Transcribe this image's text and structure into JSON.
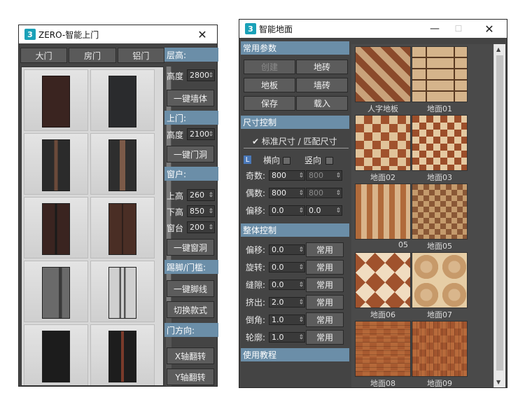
{
  "window1": {
    "title": "ZERO-智能上门",
    "tabs": [
      "大门",
      "房门",
      "铝门"
    ],
    "sections": {
      "layer_height": "层高:",
      "door": "上门:",
      "window": "窗户:",
      "skirting": "踢脚/门槛:",
      "door_dir": "门方向:"
    },
    "labels": {
      "height": "高度",
      "door_height": "高度",
      "upper_height": "上高",
      "lower_height": "下高",
      "sill": "窗台"
    },
    "values": {
      "height": "2800",
      "door_height": "2100",
      "upper_height": "260",
      "lower_height": "850",
      "sill": "200"
    },
    "buttons": {
      "wall": "一键墙体",
      "door_opening": "一键门洞",
      "window_opening": "一键窗洞",
      "skirting": "一键脚线",
      "switch_style": "切换款式",
      "flip_x": "X轴翻转",
      "flip_y": "Y轴翻转"
    },
    "colors": {
      "section_bg": "#6b8ea8",
      "panel_bg": "#444444"
    }
  },
  "window2": {
    "title": "智能地面",
    "sections": {
      "common": "常用参数",
      "size": "尺寸控制",
      "overall": "整体控制",
      "tutorial": "使用教程"
    },
    "common_buttons": [
      "创建",
      "地砖",
      "地板",
      "墙砖",
      "保存",
      "载入"
    ],
    "size": {
      "checkbox_label": "✔ 标准尺寸 / 匹配尺寸",
      "horizontal": "横向",
      "vertical": "竖向",
      "l_badge": "L",
      "odd_label": "奇数:",
      "even_label": "偶数:",
      "offset_label": "偏移:",
      "odd_val": "800",
      "odd_val2": "800",
      "even_val": "800",
      "even_val2": "800",
      "offset_val": "0.0",
      "offset_val2": "0.0"
    },
    "overall": {
      "rows": [
        {
          "label": "偏移:",
          "value": "0.0",
          "button": "常用"
        },
        {
          "label": "旋转:",
          "value": "0.0",
          "button": "常用"
        },
        {
          "label": "缝隙:",
          "value": "0.0",
          "button": "常用"
        },
        {
          "label": "挤出:",
          "value": "2.0",
          "button": "常用"
        },
        {
          "label": "倒角:",
          "value": "1.0",
          "button": "常用"
        },
        {
          "label": "轮廓:",
          "value": "1.0",
          "button": "常用"
        }
      ]
    },
    "tiles": [
      "人字地板",
      "地面01",
      "地面02",
      "地面03",
      "",
      "",
      "地面06",
      "地面07",
      "地面08",
      "地面09"
    ],
    "tile_partial_labels": [
      "05",
      "地面05"
    ]
  }
}
